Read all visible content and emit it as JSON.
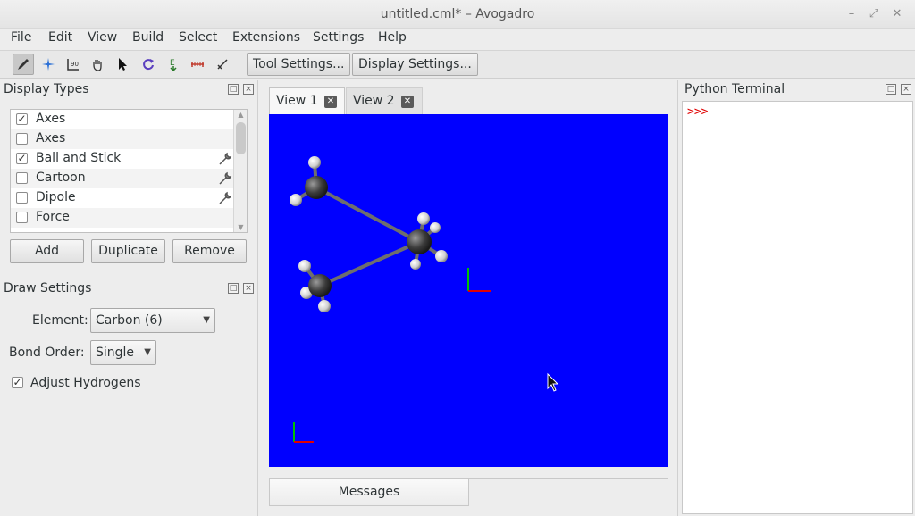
{
  "window": {
    "title": "untitled.cml* – Avogadro",
    "controls": [
      "minimize-icon",
      "maximize-icon",
      "close-icon"
    ]
  },
  "menu": [
    "File",
    "Edit",
    "View",
    "Build",
    "Select",
    "Extensions",
    "Settings",
    "Help"
  ],
  "toolbar": {
    "tools": [
      "draw-pencil-icon",
      "navigate-icon",
      "measure-icon",
      "manipulate-hand-icon",
      "select-arrow-icon",
      "rotate-icon",
      "auto-optimize-icon",
      "bond-centric-icon",
      "align-icon"
    ],
    "tool_settings_label": "Tool Settings...",
    "display_settings_label": "Display Settings..."
  },
  "display_types": {
    "title": "Display Types",
    "items": [
      {
        "label": "Axes",
        "checked": true,
        "has_settings": false
      },
      {
        "label": "Axes",
        "checked": false,
        "has_settings": false
      },
      {
        "label": "Ball and Stick",
        "checked": true,
        "has_settings": true
      },
      {
        "label": "Cartoon",
        "checked": false,
        "has_settings": true
      },
      {
        "label": "Dipole",
        "checked": false,
        "has_settings": true
      },
      {
        "label": "Force",
        "checked": false,
        "has_settings": false
      }
    ],
    "buttons": {
      "add": "Add",
      "duplicate": "Duplicate",
      "remove": "Remove"
    }
  },
  "draw_settings": {
    "title": "Draw Settings",
    "element_label": "Element:",
    "element_value": "Carbon (6)",
    "bond_order_label": "Bond Order:",
    "bond_order_value": "Single",
    "adjust_hydrogens_label": "Adjust Hydrogens",
    "adjust_hydrogens_checked": true
  },
  "views": {
    "tabs": [
      {
        "label": "View 1",
        "active": true
      },
      {
        "label": "View 2",
        "active": false
      }
    ],
    "background_color": "#0000ff"
  },
  "messages_tab": "Messages",
  "python_terminal": {
    "title": "Python Terminal",
    "prompt": ">>>"
  },
  "colors": {
    "accent_prompt": "#e00000",
    "viewport": "#0000ff"
  }
}
